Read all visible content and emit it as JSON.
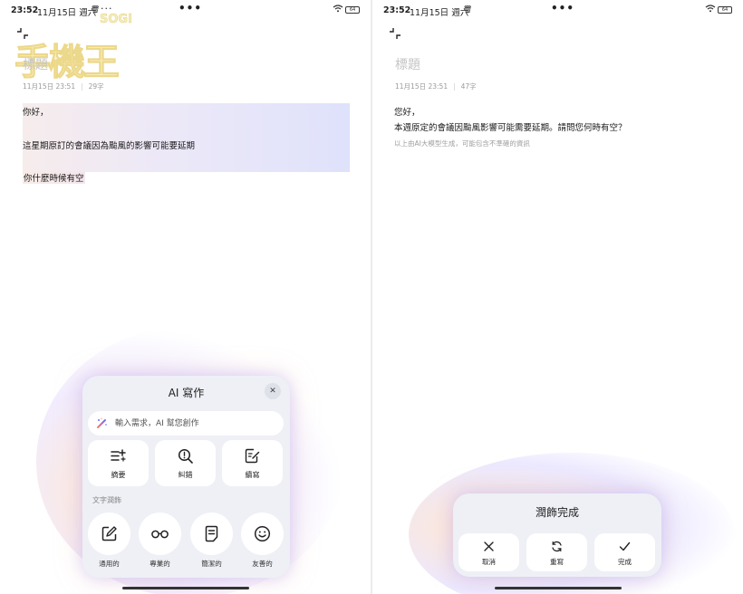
{
  "left": {
    "status": {
      "time": "23:52",
      "date": "11月15日 週六",
      "more": "•••",
      "ellipsis": "···",
      "battery": "64"
    },
    "watermark": {
      "brand": "SOGI",
      "text": "手機王"
    },
    "note": {
      "title_placeholder": "標題",
      "datetime": "11月15日 23:51",
      "char_count": "29字",
      "lines": [
        "你好，",
        "這星期原訂的會議因為颱風的影響可能要延期",
        "你什麼時候有空"
      ]
    },
    "ai_panel": {
      "title": "AI 寫作",
      "close": "✕",
      "input_placeholder": "輸入需求，AI 幫您創作",
      "actions": [
        {
          "label": "摘要",
          "icon": "summary-icon"
        },
        {
          "label": "糾錯",
          "icon": "proofread-icon"
        },
        {
          "label": "續寫",
          "icon": "continue-writing-icon"
        }
      ],
      "section_label": "文字潤飾",
      "tones": [
        {
          "label": "通用的",
          "icon": "edit-pen-icon"
        },
        {
          "label": "專業的",
          "icon": "glasses-icon"
        },
        {
          "label": "簡潔的",
          "icon": "document-icon"
        },
        {
          "label": "友善的",
          "icon": "smiley-icon"
        }
      ]
    }
  },
  "right": {
    "status": {
      "time": "23:52",
      "date": "11月15日 週六",
      "more": "•••",
      "battery": "64"
    },
    "note": {
      "title_placeholder": "標題",
      "datetime": "11月15日 23:51",
      "char_count": "47字",
      "lines": [
        "您好，",
        "本週原定的會議因颱風影響可能需要延期。請問您何時有空？"
      ],
      "disclaimer": "以上由AI大模型生成，可能包含不準確的資訊"
    },
    "done_panel": {
      "title": "潤飾完成",
      "buttons": [
        {
          "label": "取消",
          "icon": "close-icon"
        },
        {
          "label": "重寫",
          "icon": "refresh-icon"
        },
        {
          "label": "完成",
          "icon": "checkmark-icon"
        }
      ]
    }
  }
}
